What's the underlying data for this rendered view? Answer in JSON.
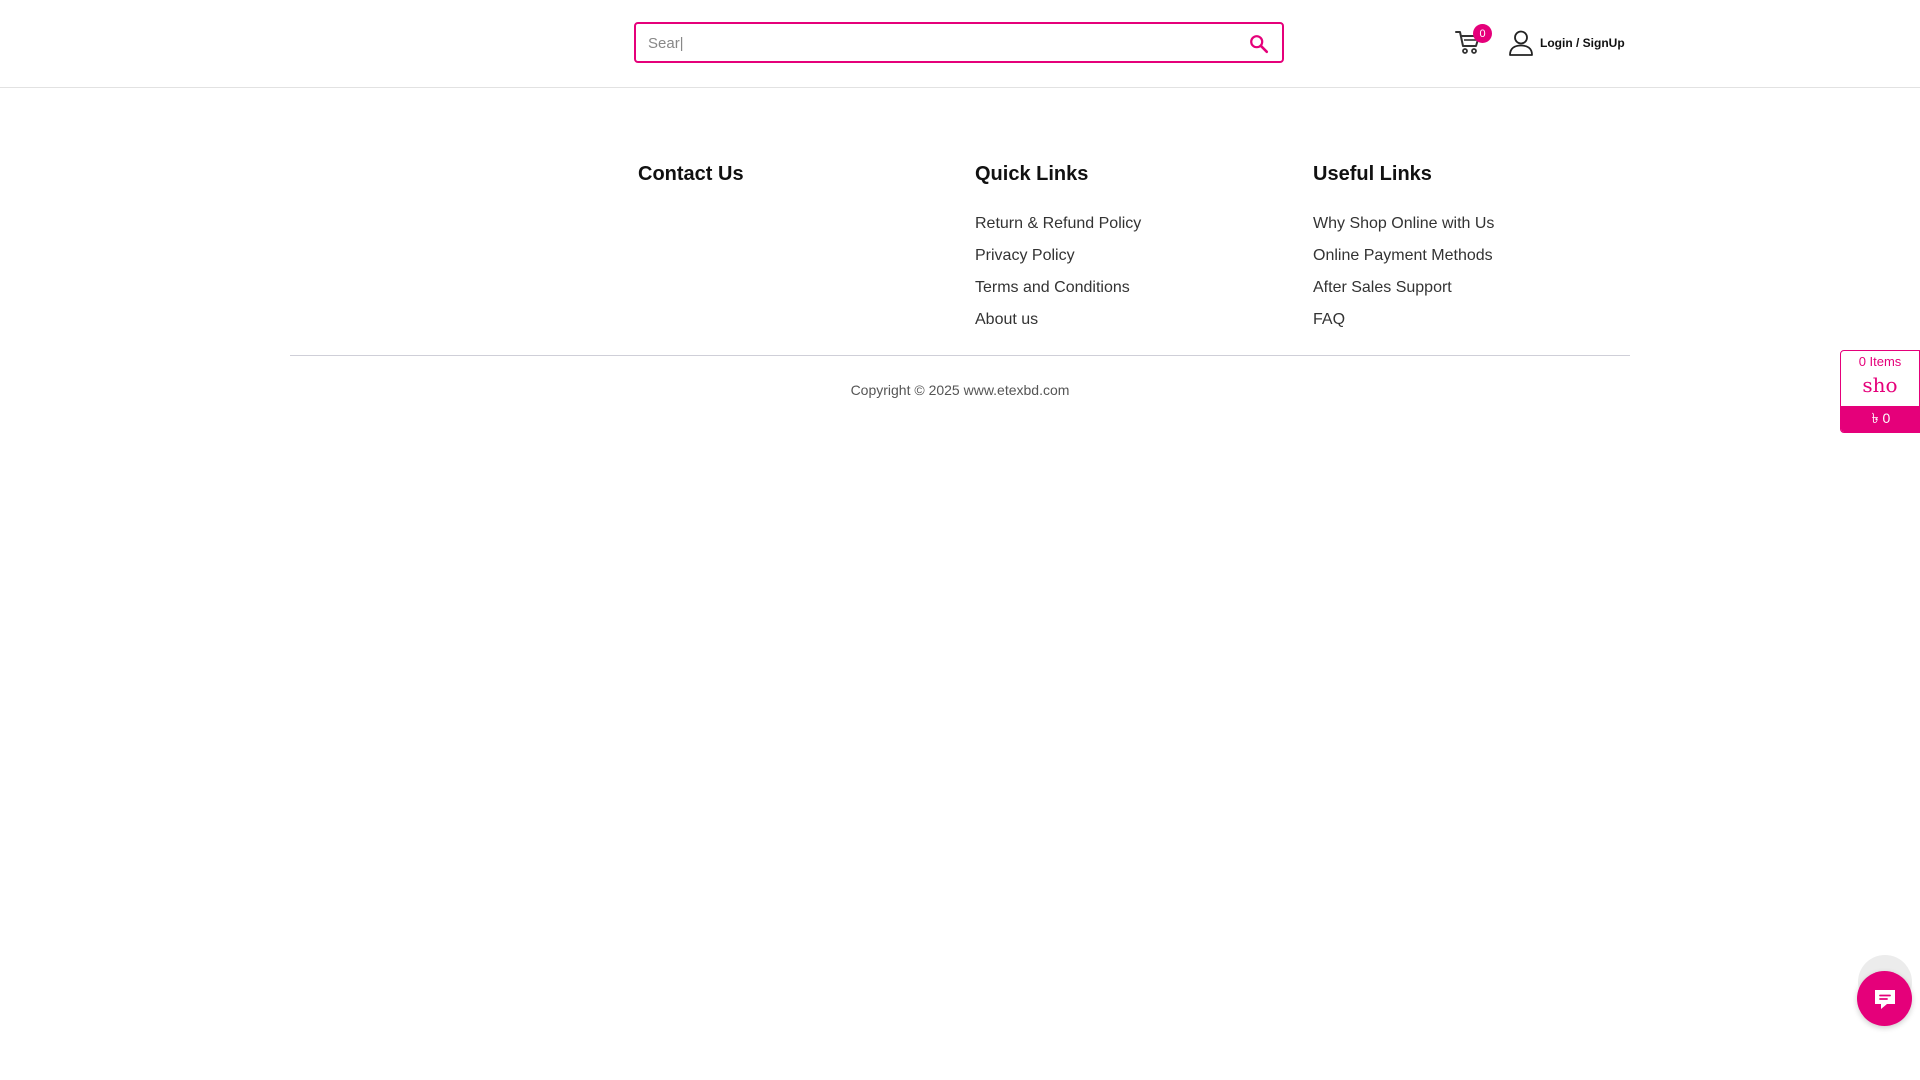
{
  "header": {
    "search": {
      "value": "",
      "placeholder": "Sear|"
    },
    "cart_count": "0",
    "login_label": "Login / SignUp"
  },
  "footer": {
    "contact": {
      "title": "Contact Us"
    },
    "quick_links": {
      "title": "Quick Links",
      "items": [
        {
          "label": "Return & Refund Policy"
        },
        {
          "label": "Privacy Policy"
        },
        {
          "label": "Terms and Conditions"
        },
        {
          "label": "About us"
        }
      ]
    },
    "useful_links": {
      "title": "Useful Links",
      "items": [
        {
          "label": "Why Shop Online with Us"
        },
        {
          "label": "Online Payment Methods"
        },
        {
          "label": "After Sales Support"
        },
        {
          "label": "FAQ"
        }
      ]
    },
    "copyright": "Copyright © 2025 www.etexbd.com"
  },
  "mini_cart": {
    "items_label": "0 Items",
    "icon_text": "sho",
    "total": "৳ 0"
  },
  "colors": {
    "accent": "#e5007a"
  },
  "icons": {
    "search": "search-icon",
    "cart": "cart-icon",
    "user": "user-icon",
    "chat": "chat-icon"
  }
}
